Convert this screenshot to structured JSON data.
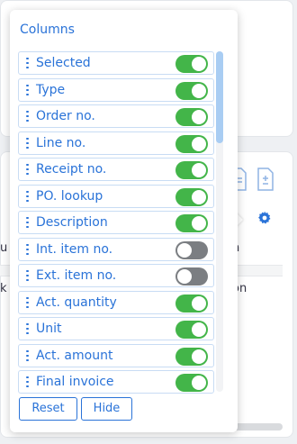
{
  "background": {
    "table": {
      "header_left": "u",
      "header_right": "n",
      "row_left": "k",
      "row_right": "on"
    }
  },
  "popover": {
    "title": "Columns",
    "columns": [
      {
        "label": "Selected",
        "enabled": true
      },
      {
        "label": "Type",
        "enabled": true
      },
      {
        "label": "Order no.",
        "enabled": true
      },
      {
        "label": "Line no.",
        "enabled": true
      },
      {
        "label": "Receipt no.",
        "enabled": true
      },
      {
        "label": "PO. lookup",
        "enabled": true
      },
      {
        "label": "Description",
        "enabled": true
      },
      {
        "label": "Int. item no.",
        "enabled": false
      },
      {
        "label": "Ext. item no.",
        "enabled": false
      },
      {
        "label": "Act. quantity",
        "enabled": true
      },
      {
        "label": "Unit",
        "enabled": true
      },
      {
        "label": "Act. amount",
        "enabled": true
      },
      {
        "label": "Final invoice",
        "enabled": true
      }
    ],
    "buttons": {
      "reset": "Reset",
      "hide": "Hide"
    }
  },
  "colors": {
    "accent": "#2a73d8",
    "toggle_on": "#43b549",
    "toggle_off": "#7b7e82"
  }
}
